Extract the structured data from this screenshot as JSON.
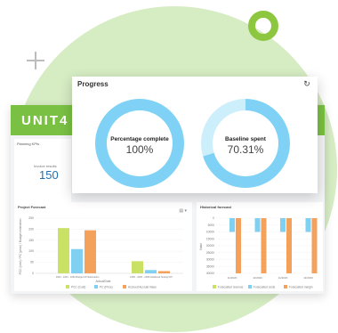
{
  "brand": {
    "logo_text": "UNIT4",
    "accent": "#7ac143",
    "ring": "#8dc63f"
  },
  "progress": {
    "title": "Progress",
    "refresh_icon": "refresh-icon",
    "percentage_complete": {
      "label": "Percentage complete",
      "value_text": "100%",
      "value": 100
    },
    "baseline_spent": {
      "label": "Baseline spent",
      "value_text": "70.31%",
      "value": 70.31
    },
    "colors": {
      "fill": "#7fd2f5",
      "track": "#cdeefb"
    }
  },
  "kpi": {
    "title": "Planning KPIs",
    "subtitle": "Invoice results",
    "value": "150"
  },
  "project_forecast": {
    "title": "Project Forecast",
    "y_axis_label": "PCC (cost) / PC (price) / Budget estimation",
    "x_axis_label": "Actual/Date",
    "y_ticks": [
      "250",
      "200",
      "150",
      "100",
      "50",
      "0"
    ],
    "category_labels": [
      "1063 - 1063 - 1063 Budget KPI Estimation",
      "1065 - 1065 - 1065 Additional Testing KPI"
    ],
    "legend": [
      "PCC (Cost)",
      "PC (Price)",
      "Accrued Accrual Value"
    ],
    "tools": "▤ ▾"
  },
  "historical_forecast": {
    "title": "Historical forecast",
    "y_axis_label": "Value",
    "y_ticks": [
      "0",
      "5000",
      "10000",
      "15000",
      "20000",
      "25000",
      "30000",
      "35000",
      "40000"
    ],
    "category_labels": [
      "11/2020",
      "11/2020",
      "11/2020",
      "11/2020"
    ],
    "legend": [
      "Forecasted revenue",
      "Forecasted costs",
      "Forecasted margin"
    ]
  },
  "chart_data": [
    {
      "type": "bar",
      "title": "Project Forecast",
      "ylabel": "PCC (cost) / PC (price) / Budget estimation",
      "xlabel": "Actual/Date",
      "ylim": [
        0,
        250
      ],
      "categories": [
        "1063 - 1063 - 1063 Budget KPI Estimation",
        "1065 - 1065 - 1065 Additional Testing KPI"
      ],
      "series": [
        {
          "name": "PCC (Cost)",
          "color": "#c9e266",
          "values": [
            205,
            55
          ]
        },
        {
          "name": "PC (Price)",
          "color": "#80d0f2",
          "values": [
            110,
            15
          ]
        },
        {
          "name": "Accrued Accrual Value",
          "color": "#f4a15c",
          "values": [
            195,
            10
          ]
        }
      ]
    },
    {
      "type": "bar",
      "title": "Historical forecast",
      "ylabel": "Value",
      "ylim": [
        0,
        40000
      ],
      "categories": [
        "11/2020",
        "11/2020",
        "11/2020",
        "11/2020"
      ],
      "series": [
        {
          "name": "Forecasted revenue",
          "color": "#c9e266",
          "values": [
            0,
            0,
            0,
            0
          ]
        },
        {
          "name": "Forecasted costs",
          "color": "#80d0f2",
          "values": [
            10000,
            10000,
            10000,
            10000
          ]
        },
        {
          "name": "Forecasted margin",
          "color": "#f4a15c",
          "values": [
            40000,
            40000,
            40000,
            40000
          ]
        }
      ]
    }
  ]
}
